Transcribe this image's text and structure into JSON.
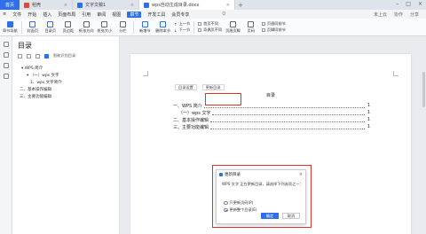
{
  "titlebar": {
    "home_tab": "首页",
    "tabs": [
      {
        "label": "稻壳",
        "color": "#e0483b"
      },
      {
        "label": "文字文稿1",
        "color": "#2f6fec"
      },
      {
        "label": "wps自动生成目录.docx",
        "color": "#2f6fec"
      }
    ]
  },
  "menubar": {
    "file": "文件",
    "items": [
      "开始",
      "插入",
      "页面布局",
      "引用",
      "审阅",
      "视图",
      "章节",
      "开发工具",
      "会员专享"
    ],
    "active": "章节",
    "search": "Q",
    "right": [
      "未上云",
      "协作",
      "分享"
    ]
  },
  "ribbon": {
    "buttons": [
      "章节导航",
      "封面页",
      "目录页",
      "页边距",
      "纸张方向",
      "纸张大小",
      "分栏",
      "新增节",
      "删除本节",
      "上一节",
      "下一节"
    ],
    "checks": [
      "首页不同",
      "奇偶页不同"
    ],
    "buttons2": [
      "页眉页脚",
      "页码"
    ],
    "checks2": [
      "页眉同前节",
      "页脚同前节"
    ]
  },
  "navpanel": {
    "title": "目录",
    "option_label": "智能识别目录",
    "items": [
      {
        "level": 1,
        "text": "WPS 简介"
      },
      {
        "level": 2,
        "text": "（一）wps 文字"
      },
      {
        "level": 3,
        "text": "1、wps 文字简介"
      },
      {
        "level": 1,
        "text": "二、基本操作编辑"
      },
      {
        "level": 1,
        "text": "三、主要功能编辑"
      }
    ]
  },
  "document": {
    "toc_tools": [
      "目录设置",
      "更新目录"
    ],
    "toc_heading": "目录",
    "toc_lines": [
      {
        "text": "一、WPS 简介",
        "page": "1"
      },
      {
        "text": "（一）wps 文字",
        "page": "1"
      },
      {
        "text": "二、基本操作编辑",
        "page": "1"
      },
      {
        "text": "三、主要功能编辑",
        "page": "1"
      }
    ]
  },
  "dialog": {
    "title": "更新目录",
    "message": "WPS 文字 正在更新目录，请选择下列选项之一：",
    "options": [
      "只更新页码(P)",
      "更新整个目录(E)"
    ],
    "selected": 1,
    "ok": "确定",
    "cancel": "取消"
  },
  "colors": {
    "accent": "#2f6fec",
    "highlight": "#d9352b"
  }
}
